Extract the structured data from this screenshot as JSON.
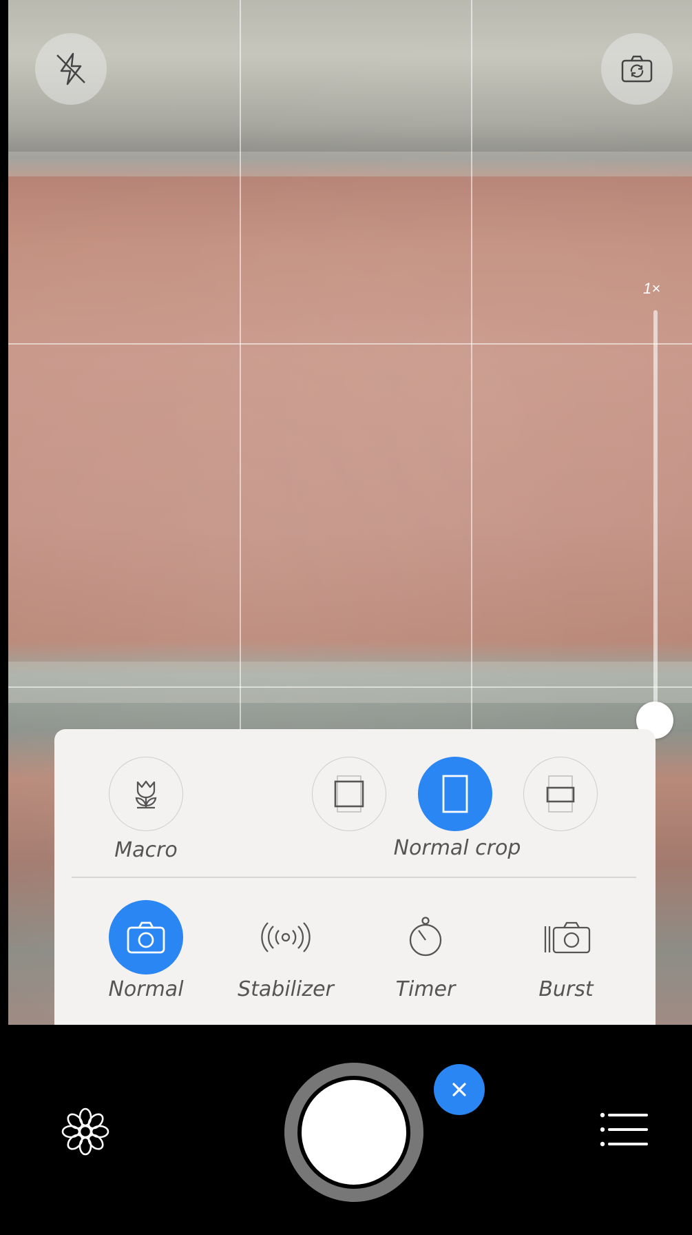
{
  "viewfinder": {
    "zoom_label": "1×",
    "zoom_level": 1,
    "flash_icon": "flash-off-icon",
    "switch_camera_icon": "switch-camera-icon"
  },
  "options_panel": {
    "macro": {
      "label": "Macro",
      "icon": "tulip-icon"
    },
    "crop": {
      "label": "Normal crop",
      "options": [
        {
          "name": "square",
          "icon": "crop-square-icon",
          "active": false
        },
        {
          "name": "normal",
          "icon": "crop-portrait-icon",
          "active": true
        },
        {
          "name": "wide",
          "icon": "crop-wide-icon",
          "active": false
        }
      ]
    },
    "modes": [
      {
        "label": "Normal",
        "icon": "camera-icon",
        "active": true
      },
      {
        "label": "Stabilizer",
        "icon": "stabilizer-icon",
        "active": false
      },
      {
        "label": "Timer",
        "icon": "timer-icon",
        "active": false
      },
      {
        "label": "Burst",
        "icon": "burst-icon",
        "active": false
      }
    ]
  },
  "bottom_bar": {
    "left_icon": "flower-icon",
    "right_icon": "menu-icon",
    "shutter": "shutter-button",
    "close_badge": "close-icon"
  },
  "colors": {
    "accent": "#2a86f3",
    "panel_bg": "#f4f2f1",
    "label_text": "#555555"
  }
}
